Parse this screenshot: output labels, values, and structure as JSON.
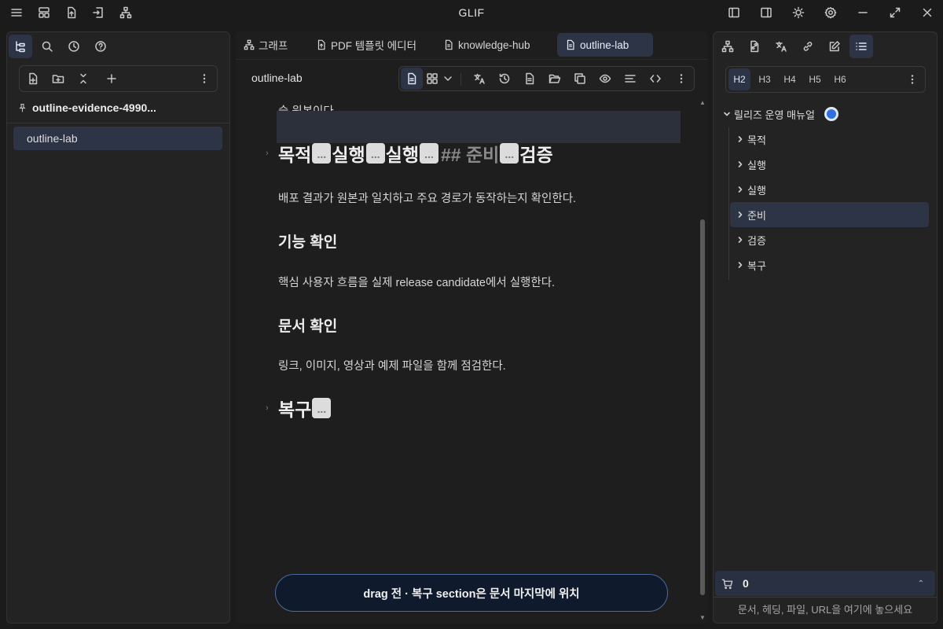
{
  "app": {
    "title": "GLIF"
  },
  "titlebar": {
    "left_icons": [
      "menu-icon",
      "layout-icon",
      "file-upload-icon",
      "file-import-icon",
      "sitemap-icon"
    ],
    "right_icons": [
      "left-sidebar-icon",
      "right-sidebar-icon",
      "sun-icon",
      "gear-icon",
      "minimize-icon",
      "maximize-icon",
      "close-icon"
    ]
  },
  "left": {
    "nav_icons": [
      "file-tree-icon",
      "search-icon",
      "history-icon",
      "help-icon"
    ],
    "toolbar_icons": [
      "new-file-icon",
      "new-folder-icon",
      "collapse-all-icon",
      "plus-icon",
      "more-icon"
    ],
    "vault_name": "outline-evidence-4990...",
    "files": [
      "outline-lab"
    ]
  },
  "tabs": [
    {
      "label": "그래프",
      "icon": "graph-icon"
    },
    {
      "label": "PDF 템플릿 에디터",
      "icon": "pdf-icon"
    },
    {
      "label": "knowledge-hub",
      "icon": "file-icon"
    },
    {
      "label": "outline-lab",
      "icon": "file-icon"
    }
  ],
  "editor": {
    "doc_title": "outline-lab",
    "toolbar_icons": [
      "document-view-icon",
      "grid-view-icon",
      "chevron-down-icon",
      "translate-icon",
      "history-icon",
      "file-text-icon",
      "folder-open-icon",
      "copy-icon",
      "eye-icon",
      "align-icon",
      "code-icon",
      "more-icon"
    ],
    "top_partial": "습 원본이다.",
    "heading_main": {
      "parts": [
        "목적",
        "실행",
        "실행"
      ],
      "raw": "## 준비",
      "last": "검증"
    },
    "p1": "배포 결과가 원본과 일치하고 주요 경로가 동작하는지 확인한다.",
    "h3_1": "기능 확인",
    "p2": "핵심 사용자 흐름을 실제 release candidate에서 실행한다.",
    "h3_2": "문서 확인",
    "p3": "링크, 이미지, 영상과 예제 파일을 함께 점검한다.",
    "heading_restore": "복구",
    "ellipsis": "...",
    "status_pill": "drag 전 · 복구 section은 문서 마지막에 위치"
  },
  "right": {
    "tab_icons": [
      "sitemap-icon",
      "file-link-icon",
      "translate-icon",
      "link-icon",
      "edit-icon",
      "list-icon"
    ],
    "heading_levels": [
      "H2",
      "H3",
      "H4",
      "H5",
      "H6"
    ],
    "outline_root": "릴리즈 운영 매뉴얼",
    "outline_items": [
      "목적",
      "실행",
      "실행",
      "준비",
      "검증",
      "복구"
    ],
    "active_item_index": 3,
    "cart_count": "0",
    "drop_hint": "문서, 헤딩, 파일, URL을 여기에 놓으세요"
  },
  "colors": {
    "accent": "#2f6fe0",
    "active_bg": "#2c3446",
    "background": "#1b1b1b"
  }
}
